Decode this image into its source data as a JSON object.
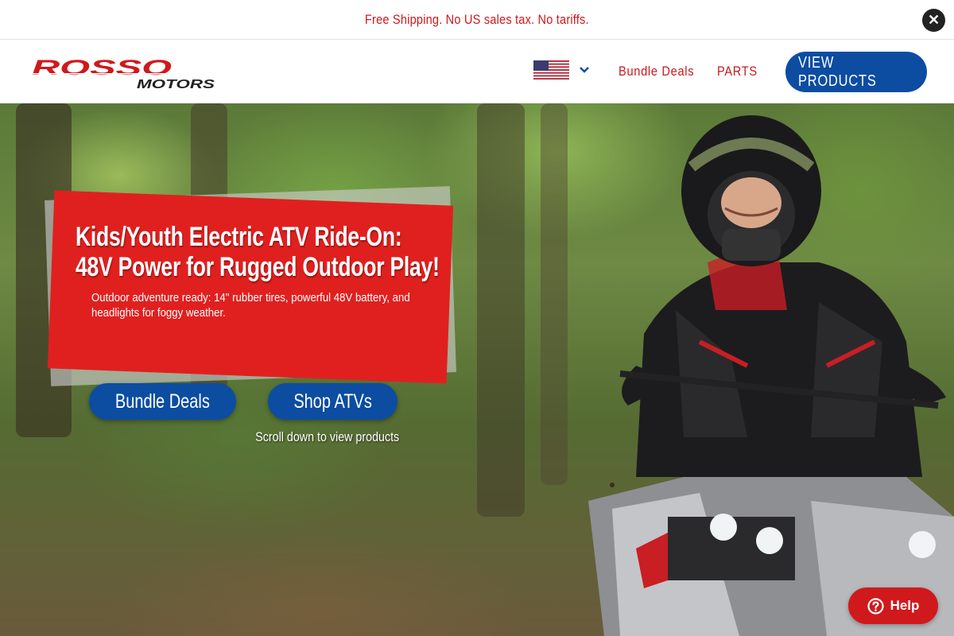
{
  "announcement": {
    "text": "Free Shipping. No US sales tax. No tariffs.",
    "close_icon": "close-icon",
    "close_glyph": "✕"
  },
  "header": {
    "logo_text_main": "ROSSO",
    "logo_text_sub": "MOTORS",
    "country_flag": "us-flag-icon",
    "nav": {
      "bundle_label": "Bundle Deals",
      "parts_label": "PARTS"
    },
    "cta_label": "VIEW PRODUCTS"
  },
  "hero": {
    "title_line1": "Kids/Youth Electric ATV Ride-On:",
    "title_line2": "48V Power for Rugged Outdoor Play!",
    "subtitle_line1": "Outdoor adventure ready: 14\" rubber tires, powerful 48V battery, and",
    "subtitle_line2": "headlights for foggy weather.",
    "buttons": {
      "bundle_label": "Bundle Deals",
      "shop_label": "Shop ATVs"
    },
    "scroll_note": "Scroll down to view products"
  },
  "help_widget": {
    "label": "Help",
    "icon": "question-circle-icon"
  },
  "colors": {
    "brand_red": "#d0191c",
    "brand_blue": "#0c4da2",
    "card_red": "#e0201f"
  }
}
